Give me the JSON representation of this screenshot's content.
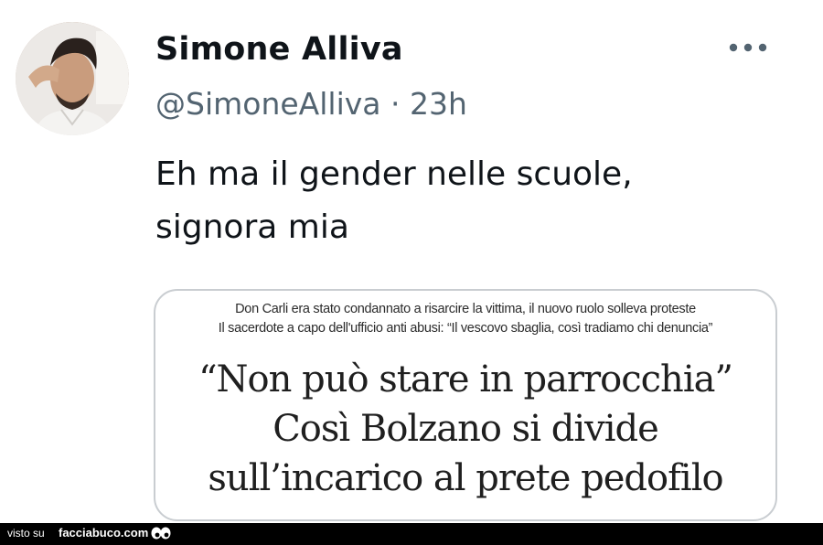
{
  "tweet": {
    "display_name": "Simone Alliva",
    "handle": "@SimoneAlliva",
    "separator": "·",
    "time": "23h",
    "text_line_1": "Eh ma il gender nelle scuole,",
    "text_line_2": "signora mia",
    "more_icon": "more-horizontal-icon",
    "avatar_icon": "profile-photo"
  },
  "media": {
    "kicker_1": "Don Carli era stato condannato a risarcire la vittima, il nuovo ruolo solleva proteste",
    "kicker_2": "Il sacerdote a capo dell'ufficio anti abusi: “Il vescovo sbaglia, così tradiamo chi denuncia”",
    "headline_1": "“Non può stare in parrocchia”",
    "headline_2": "Così Bolzano si divide",
    "headline_3": "sull’incarico al prete pedofilo"
  },
  "footer": {
    "prefix": "visto su",
    "site": "facciabuco.com",
    "logo_icon": "eyes-icon"
  },
  "colors": {
    "text": "#0f1419",
    "secondary": "#536471",
    "card_border": "#c9cdd1",
    "footer_bg": "#000000"
  }
}
